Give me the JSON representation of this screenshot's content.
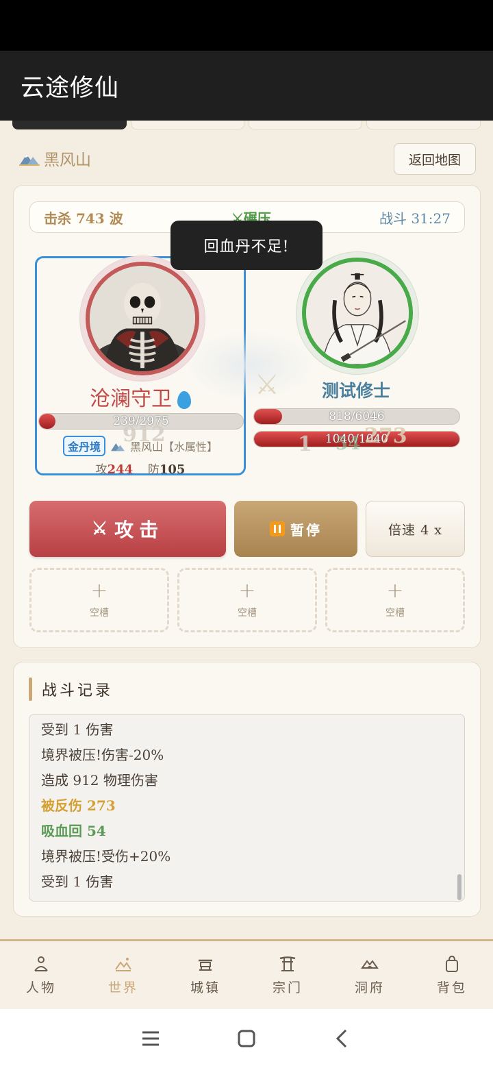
{
  "app": {
    "title": "云途修仙"
  },
  "location": {
    "name": "黑风山",
    "back_label": "返回地图"
  },
  "battle": {
    "kills": "击杀 743 波",
    "suppress": "⚔碾压",
    "time": "战斗 31:27",
    "toast": "回血丹不足!",
    "enemy": {
      "name": "沧澜守卫",
      "hp_text": "239/2975",
      "hp_pct": 8,
      "realm": "金丹境",
      "origin": "黑风山【水属性】",
      "atk_label": "攻",
      "atk": "244",
      "def_label": "防",
      "def": "105",
      "float": "912"
    },
    "player": {
      "name": "测试修士",
      "hp_text": "818/6046",
      "hp_pct": 13.5,
      "mp_text": "1040/1040",
      "mp_pct": 100,
      "float1": "1",
      "float2": "273",
      "float3": "54"
    },
    "actions": {
      "attack": "攻击",
      "pause": "暂停",
      "speed": "倍速 4 x"
    },
    "slots": [
      {
        "label": "空槽"
      },
      {
        "label": "空槽"
      },
      {
        "label": "空槽"
      }
    ]
  },
  "log": {
    "title": "战斗记录",
    "lines": [
      {
        "text": "受到 1 伤害",
        "type": "normal"
      },
      {
        "text": "境界被压!伤害-20%",
        "type": "normal"
      },
      {
        "text": "造成 912 物理伤害",
        "type": "normal"
      },
      {
        "text": "被反伤 273",
        "type": "gold"
      },
      {
        "text": "吸血回 54",
        "type": "green"
      },
      {
        "text": "境界被压!受伤+20%",
        "type": "normal"
      },
      {
        "text": "受到 1 伤害",
        "type": "normal"
      }
    ]
  },
  "nav": [
    {
      "label": "人物",
      "icon": "person-icon"
    },
    {
      "label": "世界",
      "icon": "world-icon",
      "active": true
    },
    {
      "label": "城镇",
      "icon": "town-icon"
    },
    {
      "label": "宗门",
      "icon": "sect-icon"
    },
    {
      "label": "洞府",
      "icon": "cave-icon"
    },
    {
      "label": "背包",
      "icon": "bag-icon"
    }
  ]
}
